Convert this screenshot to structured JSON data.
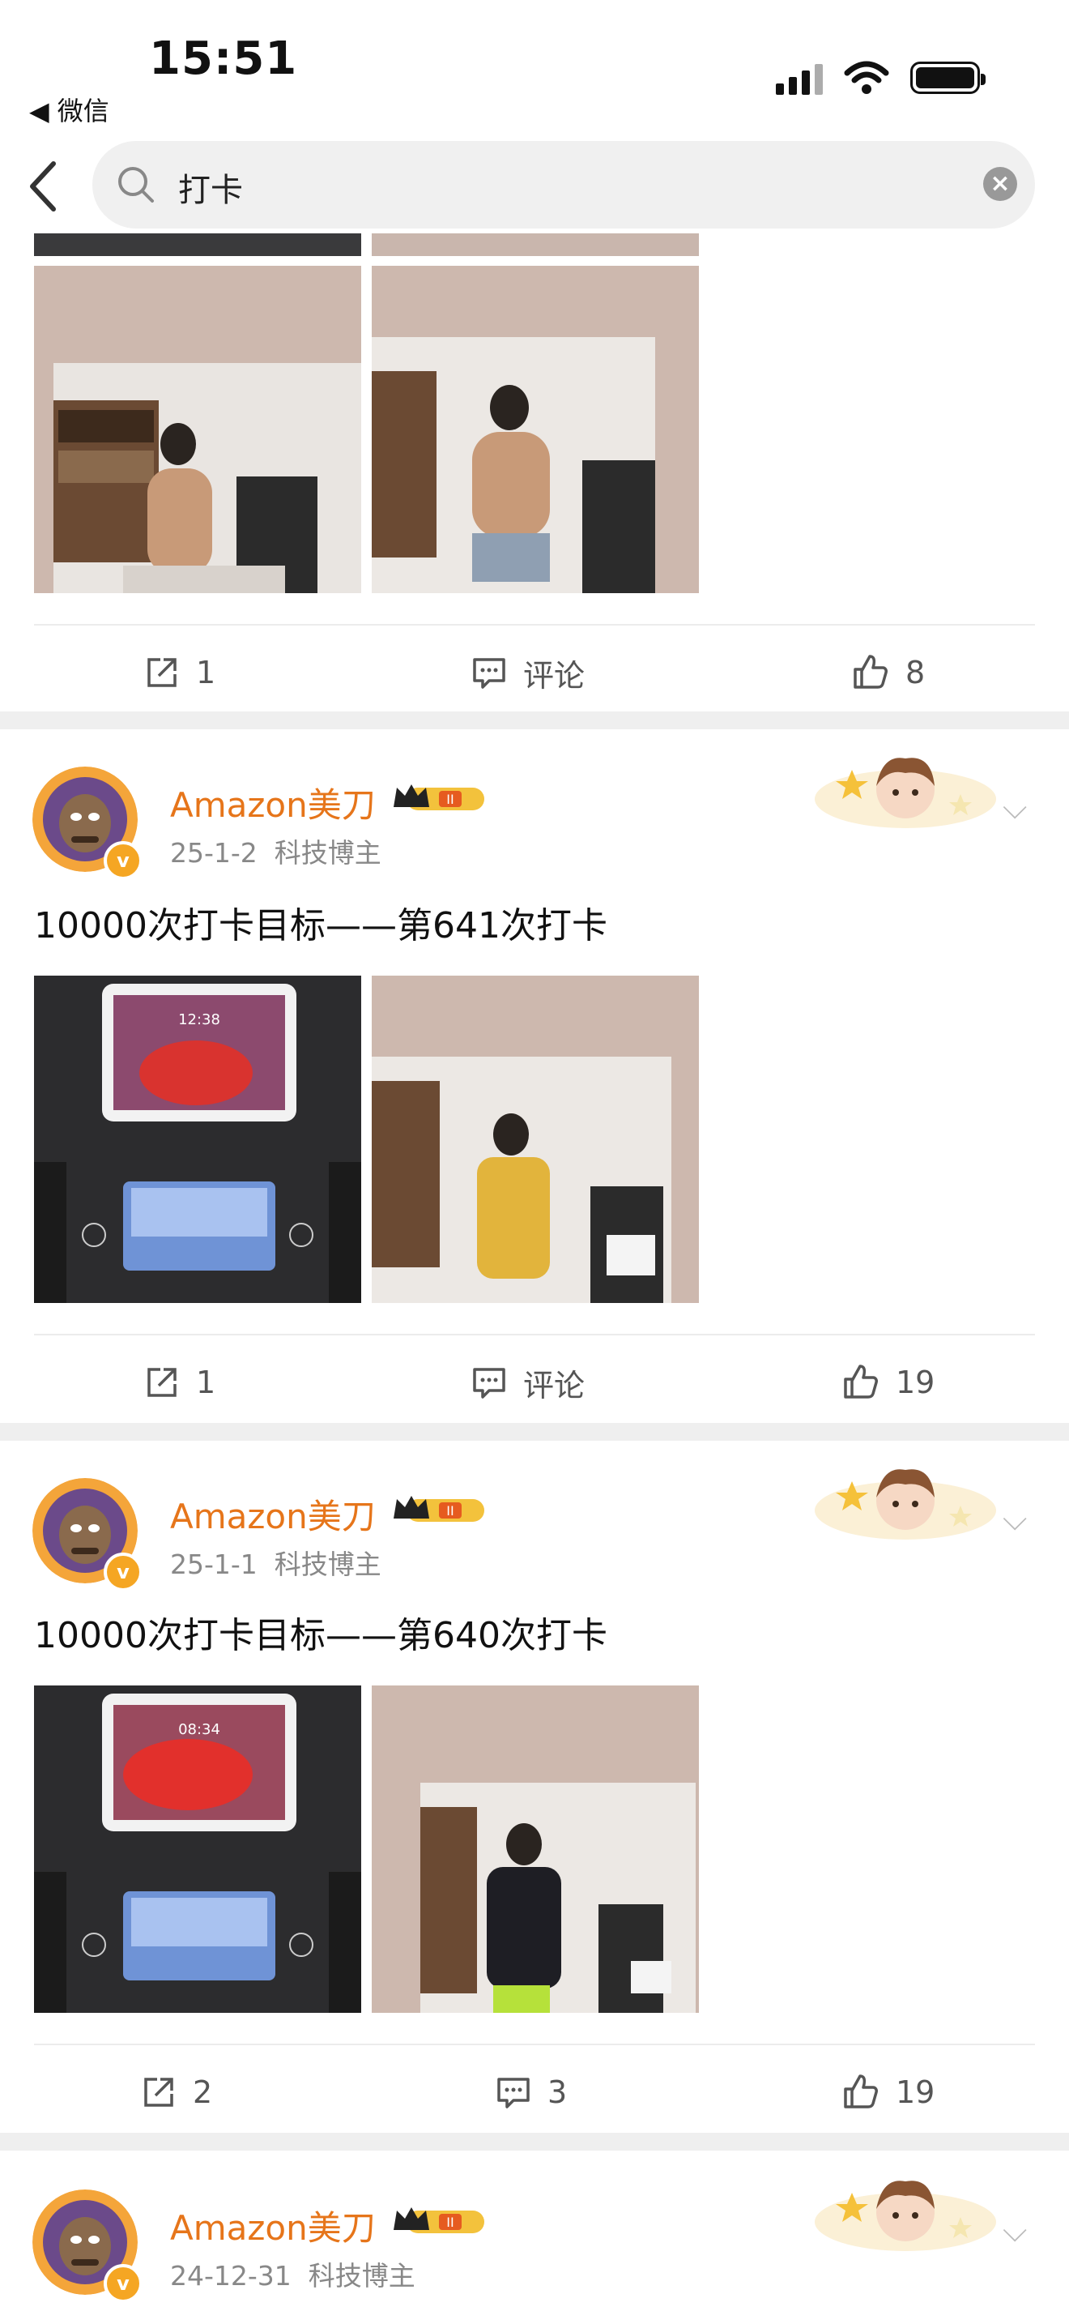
{
  "status_bar": {
    "time": "15:51",
    "back_app": "◀ 微信"
  },
  "search": {
    "query": "打卡",
    "clear_icon": "clear-icon",
    "back_icon": "back-chevron-icon"
  },
  "top_post": {
    "actions": {
      "repost": "1",
      "comment": "评论",
      "like": "8"
    }
  },
  "posts": [
    {
      "author": "Amazon美刀",
      "date": "25-1-2",
      "category": "科技博主",
      "text": "10000次打卡目标——第641次打卡",
      "actions": {
        "repost": "1",
        "comment": "评论",
        "like": "19"
      }
    },
    {
      "author": "Amazon美刀",
      "date": "25-1-1",
      "category": "科技博主",
      "text": "10000次打卡目标——第640次打卡",
      "actions": {
        "repost": "2",
        "comment": "3",
        "like": "19"
      }
    },
    {
      "author": "Amazon美刀",
      "date": "24-12-31",
      "category": "科技博主"
    }
  ],
  "colors": {
    "username": "#e6751a",
    "divider": "#efefef",
    "verified": "#f5a623"
  }
}
